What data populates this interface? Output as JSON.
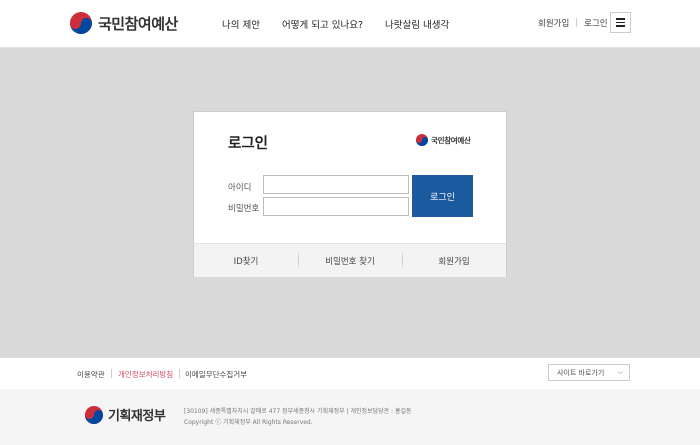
{
  "header": {
    "logo_text": "국민참여예산",
    "nav": [
      "나의 제안",
      "어떻게 되고 있나요?",
      "나랏살림 내생각"
    ],
    "util": {
      "join": "회원가입",
      "login": "로그인"
    }
  },
  "login": {
    "title": "로그인",
    "brand": "국민참여예산",
    "id_label": "아이디",
    "pw_label": "비밀번호",
    "id_value": "",
    "pw_value": "",
    "submit": "로그인",
    "links": [
      "ID찾기",
      "비밀번호 찾기",
      "회원가입"
    ],
    "accent_color": "#1b5a9e"
  },
  "footer": {
    "links": [
      "이용약관",
      "개인정보처리방침",
      "이메일무단수집거부"
    ],
    "site_select": "사이트 바로가기",
    "org": "기획재정부",
    "address": "[30109] 세종특별자치시 갈매로 477 정부세종청사 기획재정부  |  개인정보담당관 : 홍길동",
    "copyright": "Copyright ⓒ 기획재정부 All Rights Reserved."
  }
}
